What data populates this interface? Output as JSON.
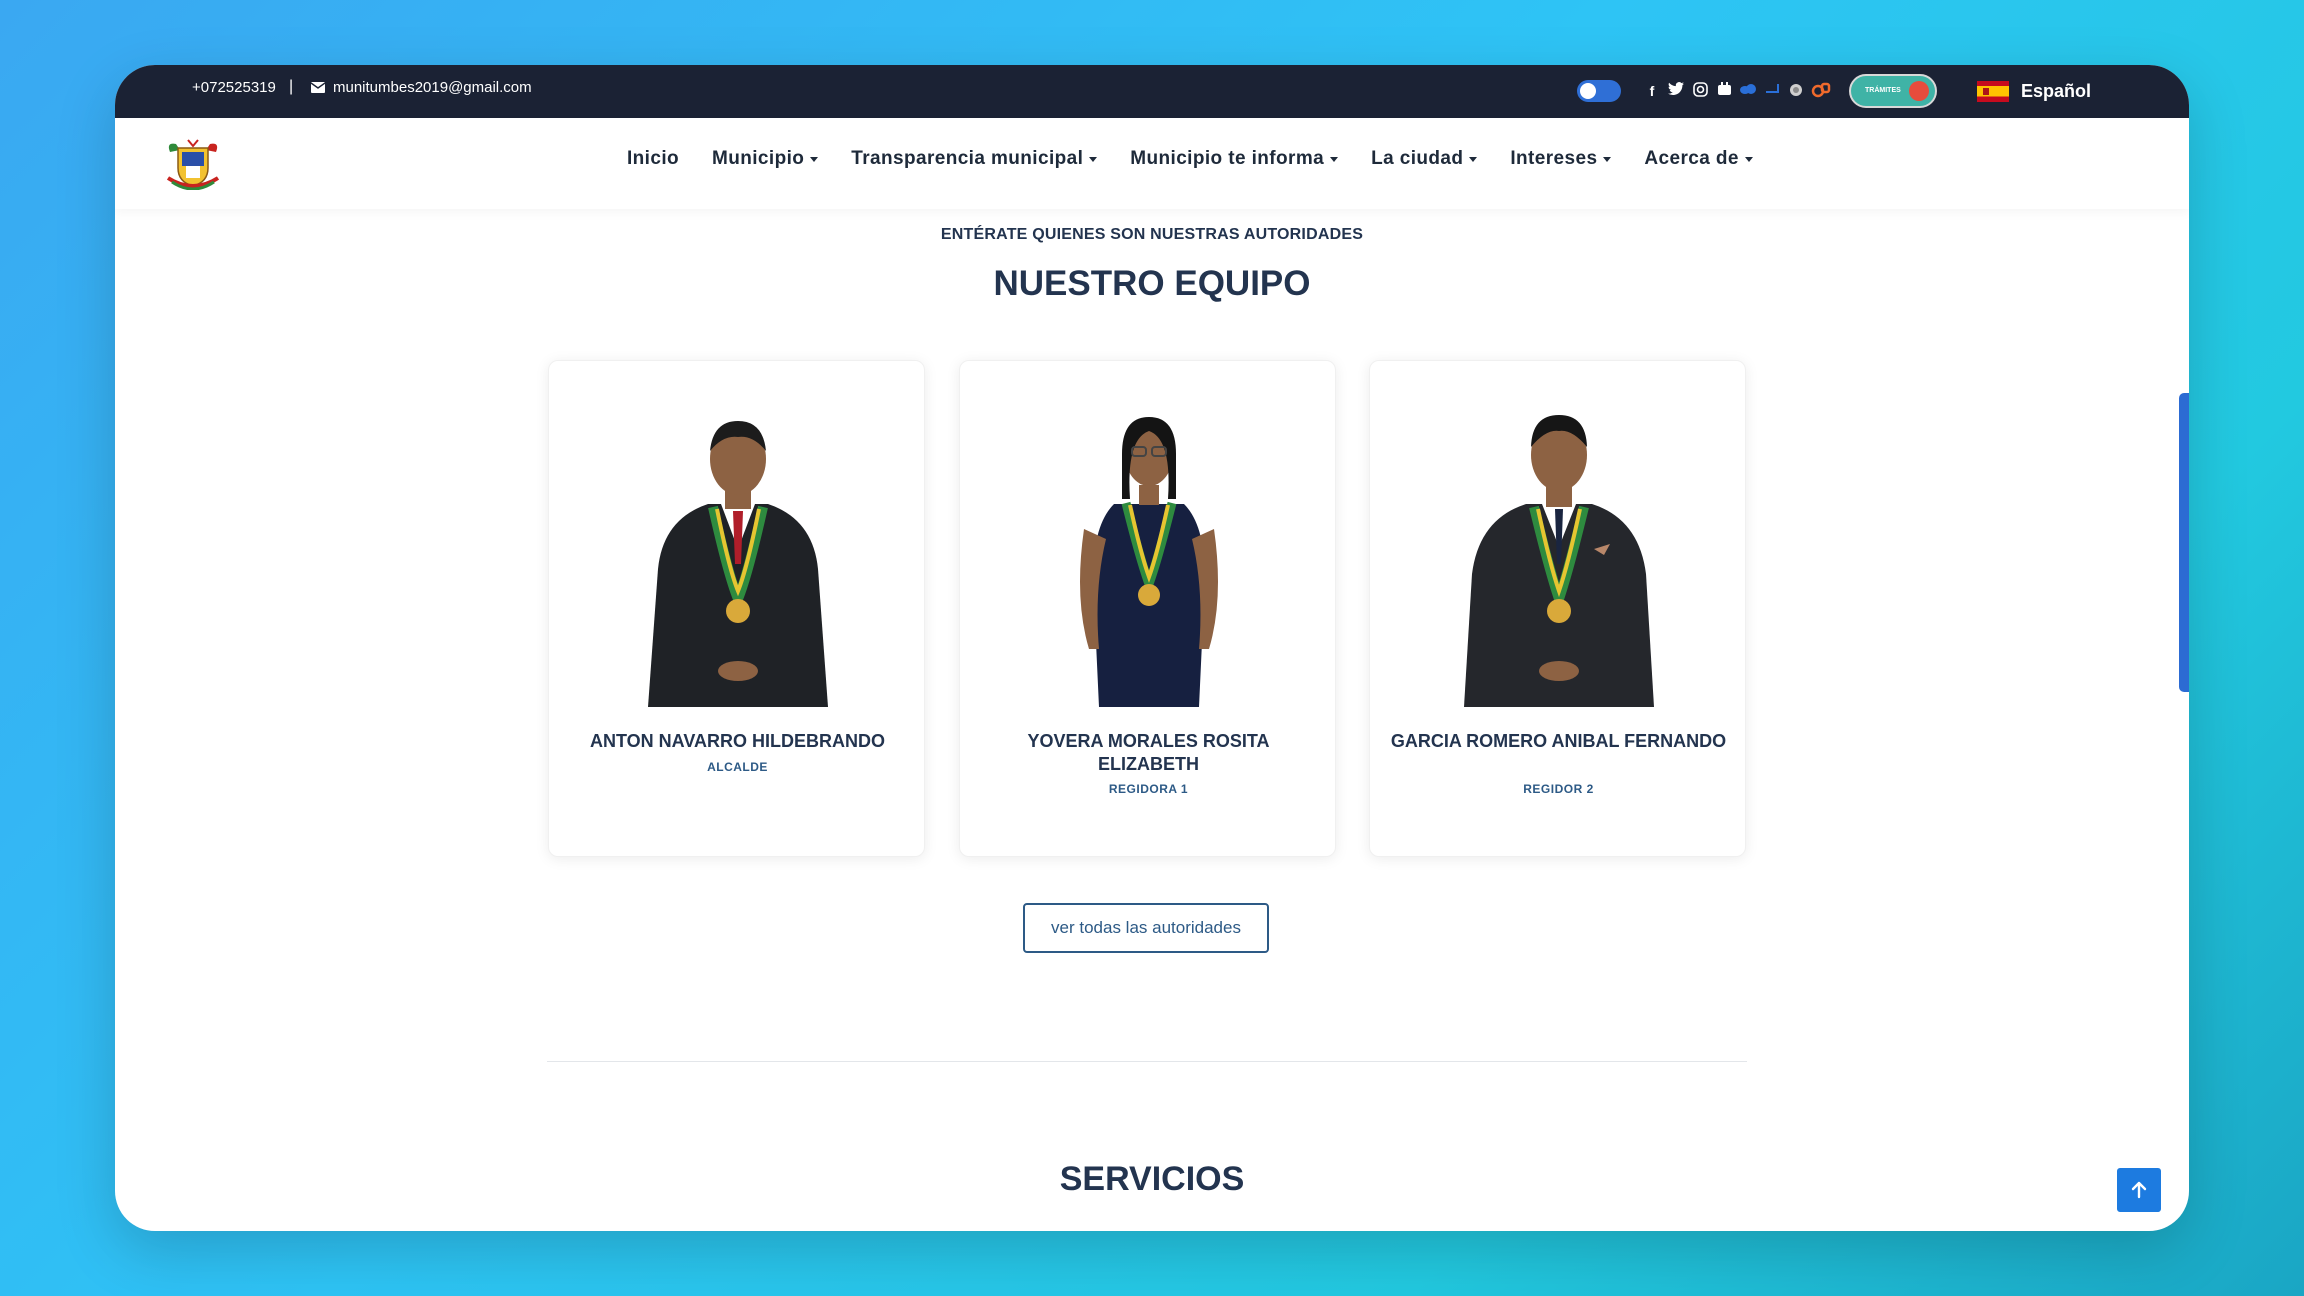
{
  "topbar": {
    "phone": "+072525319",
    "separator": "|",
    "email": "munitumbes2019@gmail.com",
    "social_icons": [
      "facebook-icon",
      "twitter-icon",
      "instagram-icon",
      "youtube-icon",
      "cloud-icon",
      "link-icon",
      "seal-icon",
      "cp-icon"
    ],
    "tramites_label": "TRÁMITES",
    "language": "Español"
  },
  "nav": {
    "items": [
      {
        "label": "Inicio",
        "dropdown": false
      },
      {
        "label": "Municipio",
        "dropdown": true
      },
      {
        "label": "Transparencia municipal",
        "dropdown": true
      },
      {
        "label": "Municipio te informa",
        "dropdown": true
      },
      {
        "label": "La ciudad",
        "dropdown": true
      },
      {
        "label": "Intereses",
        "dropdown": true
      },
      {
        "label": "Acerca de",
        "dropdown": true
      }
    ]
  },
  "team": {
    "eyebrow": "ENTÉRATE QUIENES SON NUESTRAS AUTORIDADES",
    "title": "NUESTRO EQUIPO",
    "members": [
      {
        "name": "ANTON NAVARRO HILDEBRANDO",
        "role": "ALCALDE"
      },
      {
        "name": "YOVERA MORALES ROSITA ELIZABETH",
        "role": "REGIDORA 1"
      },
      {
        "name": "GARCIA ROMERO ANIBAL FERNANDO",
        "role": "REGIDOR 2"
      }
    ],
    "button": "ver todas las autoridades"
  },
  "services": {
    "title": "SERVICIOS"
  },
  "colors": {
    "topbar": "#1b2234",
    "heading": "#23344f",
    "accent": "#2d5a86",
    "scroll_button": "#1d7be0"
  }
}
